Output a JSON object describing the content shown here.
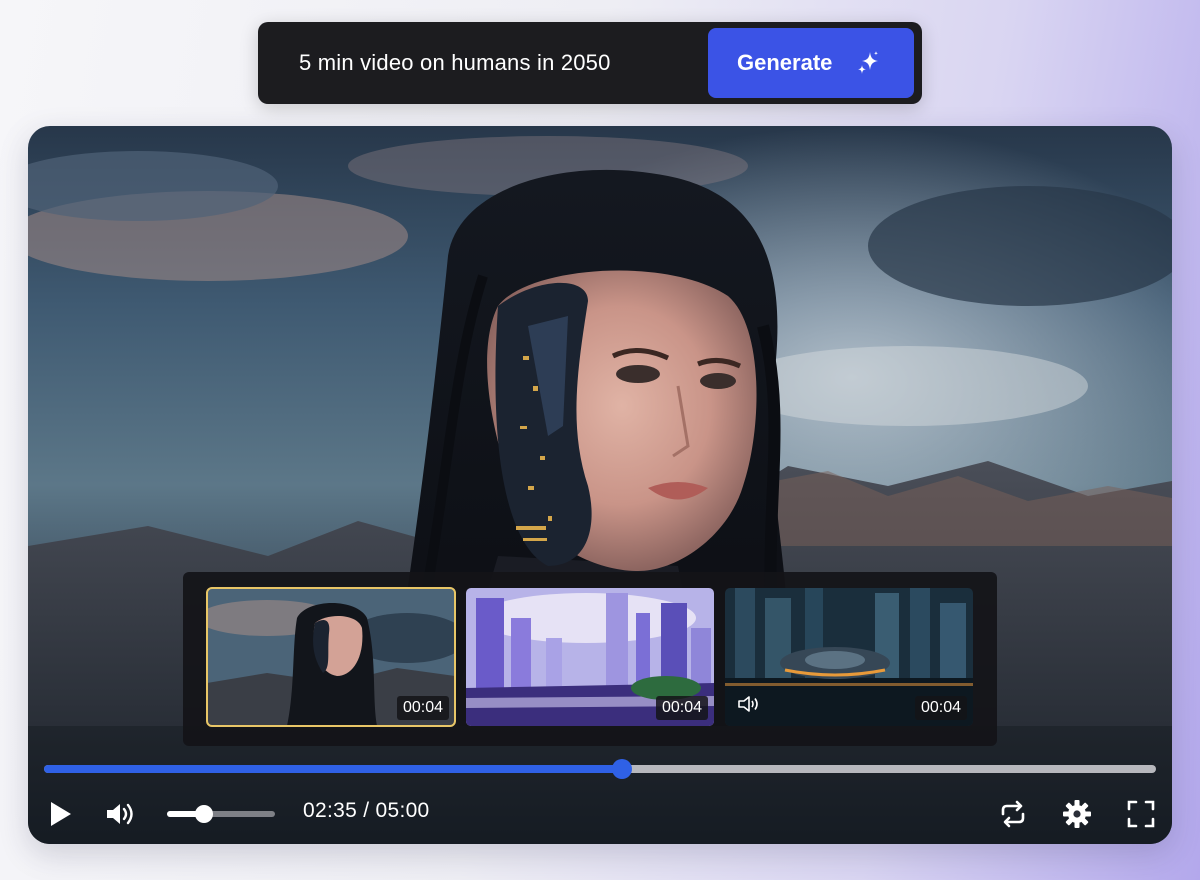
{
  "prompt": {
    "text": "5 min video on humans in 2050",
    "generate_label": "Generate"
  },
  "player": {
    "current_time": "02:35",
    "separator": "/",
    "total_time": "05:00",
    "progress_fraction": 0.52,
    "volume_fraction": 0.34,
    "accent_color": "#2f61e6"
  },
  "thumbnails": [
    {
      "duration": "00:04",
      "selected": true,
      "scene": "cyborg-woman"
    },
    {
      "duration": "00:04",
      "selected": false,
      "scene": "futuristic-city-purple"
    },
    {
      "duration": "00:04",
      "selected": false,
      "scene": "flying-car-city",
      "has_audio_icon": true
    }
  ],
  "icons": {
    "generate": "sparkle-icon",
    "play": "play-icon",
    "volume": "volume-icon",
    "loop": "loop-icon",
    "settings": "gear-icon",
    "fullscreen": "fullscreen-icon"
  },
  "colors": {
    "generate_button": "#3b53e6",
    "prompt_bar": "#1c1c1f",
    "selected_thumb_border": "#e8c667"
  }
}
